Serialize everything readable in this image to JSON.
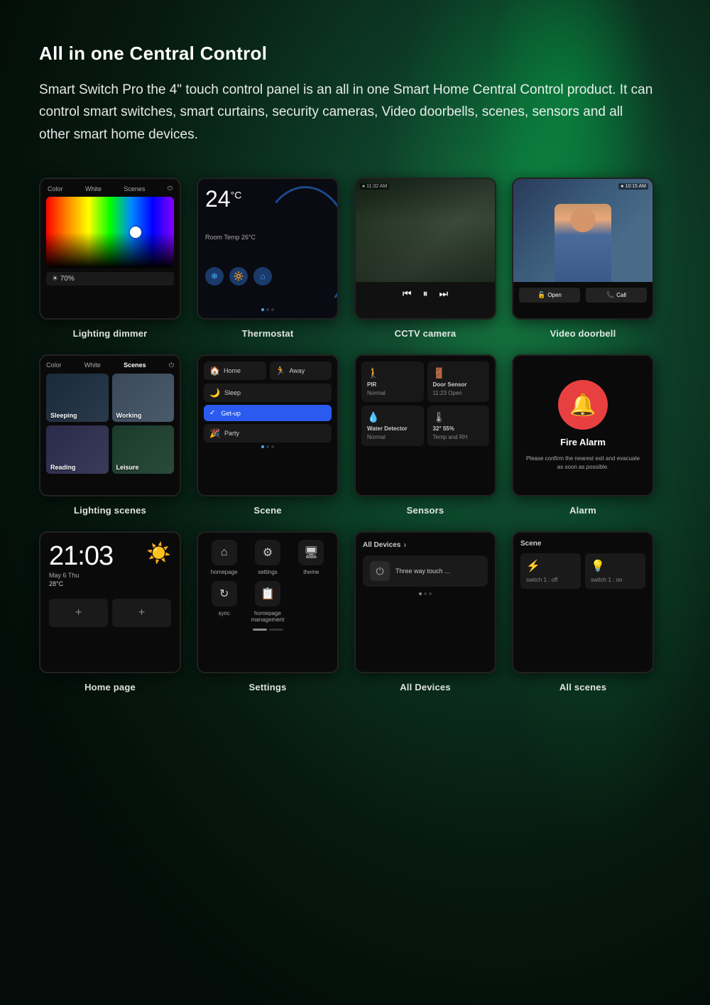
{
  "page": {
    "title": "All in one Central Control",
    "description": "Smart Switch Pro the 4\" touch control panel is an all in one Smart Home Central Control product. It can control smart switches, smart curtains, security cameras, Video doorbells, scenes, sensors and all other smart home devices."
  },
  "devices": [
    {
      "id": "lighting-dimmer",
      "label": "Lighting  dimmer",
      "screen": "lighting"
    },
    {
      "id": "thermostat",
      "label": "Thermostat",
      "screen": "thermostat"
    },
    {
      "id": "cctv",
      "label": "CCTV camera",
      "screen": "cctv"
    },
    {
      "id": "doorbell",
      "label": "Video doorbell",
      "screen": "doorbell"
    },
    {
      "id": "lighting-scenes",
      "label": "Lighting  scenes",
      "screen": "scenes"
    },
    {
      "id": "scene",
      "label": "Scene",
      "screen": "scene"
    },
    {
      "id": "sensors",
      "label": "Sensors",
      "screen": "sensors"
    },
    {
      "id": "alarm",
      "label": "Alarm",
      "screen": "alarm"
    },
    {
      "id": "homepage",
      "label": "Home page",
      "screen": "homepage"
    },
    {
      "id": "settings",
      "label": "Settings",
      "screen": "settings"
    },
    {
      "id": "alldevices",
      "label": "All Devices",
      "screen": "alldevices"
    },
    {
      "id": "allscenes",
      "label": "All scenes",
      "screen": "allscenes"
    }
  ],
  "thermostat": {
    "temp": "24",
    "unit": "°C",
    "subtitle": "Room Temp 26°C"
  },
  "alarm": {
    "title": "Fire Alarm",
    "description": "Please confirm the nearest exit and evacuate as soon as possible."
  },
  "homepage": {
    "time": "21:03",
    "date": "May 6 Thu",
    "temp": "28°C"
  },
  "alldevices": {
    "title": "All Devices",
    "item": "Three way touch ..."
  },
  "allscenes": {
    "title": "Scene",
    "switch1_off": "switch 1 : off",
    "switch1_on": "switch 1 : on"
  },
  "sensors": {
    "pir": {
      "name": "PIR",
      "status": "Normal"
    },
    "door": {
      "name": "Door Sensor",
      "status": "11:23 Open"
    },
    "water": {
      "name": "Water Detector",
      "status": "Normal"
    },
    "temp": {
      "name": "32°  55%",
      "status": "Temp and RH"
    }
  }
}
